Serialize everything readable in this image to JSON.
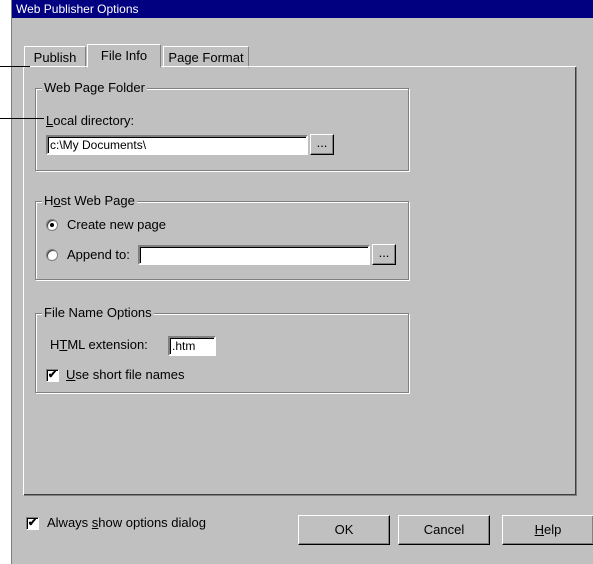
{
  "window": {
    "title": "Web Publisher Options"
  },
  "tabs": [
    {
      "label": "Publish",
      "active": false
    },
    {
      "label": "File Info",
      "active": true
    },
    {
      "label": "Page Format",
      "active": false
    }
  ],
  "web_page_folder": {
    "legend": "Web Page Folder",
    "local_directory_label_mnemonic": "L",
    "local_directory_label_rest": "ocal directory:",
    "local_directory_value": "c:\\My Documents\\",
    "browse_label": "..."
  },
  "host_web_page": {
    "legend_pre": "H",
    "legend_mnemonic": "o",
    "legend_post": "st Web Page",
    "create_new_label": "Create new page",
    "create_new_selected": true,
    "append_label": "Append to:",
    "append_selected": false,
    "append_value": "",
    "browse_label": "..."
  },
  "file_name_options": {
    "legend": "File Name Options",
    "html_ext_label_pre": "H",
    "html_ext_label_mnemonic": "T",
    "html_ext_label_post": "ML extension:",
    "html_ext_value": ".htm",
    "short_names_mnemonic": "U",
    "short_names_rest": "se short file names",
    "short_names_checked": true
  },
  "footer": {
    "always_show_pre": "Always ",
    "always_show_mnemonic": "s",
    "always_show_post": "how options dialog",
    "always_show_checked": true,
    "ok_label": "OK",
    "cancel_label": "Cancel",
    "help_mnemonic": "H",
    "help_rest": "elp"
  },
  "check_glyph": "✔"
}
